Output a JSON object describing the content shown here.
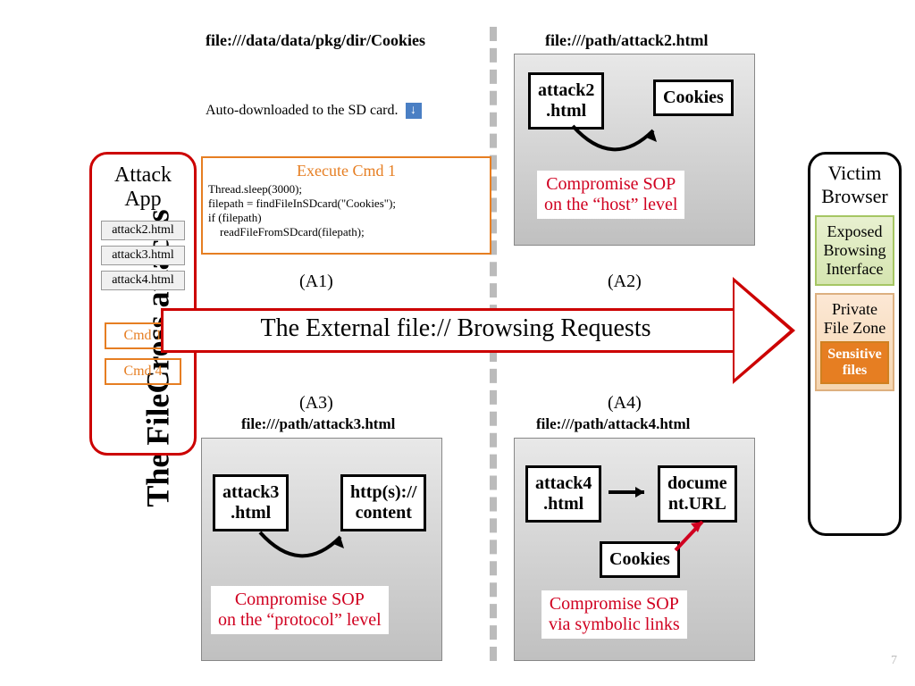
{
  "title": "The FileCross attacks",
  "urls": {
    "cookies": "file:///data/data/pkg/dir/Cookies",
    "a2": "file:///path/attack2.html",
    "a3": "file:///path/attack3.html",
    "a4": "file:///path/attack4.html"
  },
  "autodl": "Auto-downloaded to the SD card.",
  "attack_app": {
    "title": "Attack App",
    "files": [
      "attack2.html",
      "attack3.html",
      "attack4.html"
    ],
    "cmds": [
      "Cmd 1",
      "Cmd 4"
    ]
  },
  "exec": {
    "title": "Execute Cmd 1",
    "code": "Thread.sleep(3000);\nfilepath = findFileInSDcard(\"Cookies\");\nif (filepath)\n    readFileFromSDcard(filepath);"
  },
  "labels": {
    "a1": "(A1)",
    "a2": "(A2)",
    "a3": "(A3)",
    "a4": "(A4)"
  },
  "arrow_text": "The External file:// Browsing Requests",
  "victim": {
    "title": "Victim Browser",
    "box1": "Exposed Browsing Interface",
    "box2": "Private File Zone",
    "box3": "Sensitive files"
  },
  "panels": {
    "a2": {
      "box1": "attack2\n.html",
      "box2": "Cookies",
      "msg": "Compromise SOP\non the “host” level"
    },
    "a3": {
      "box1": "attack3\n.html",
      "box2": "http(s)://\ncontent",
      "msg": "Compromise SOP\non the “protocol” level"
    },
    "a4": {
      "box1": "attack4\n.html",
      "box2": "docume\nnt.URL",
      "box3": "Cookies",
      "msg": "Compromise SOP\nvia symbolic links"
    }
  },
  "pagenum": "7"
}
